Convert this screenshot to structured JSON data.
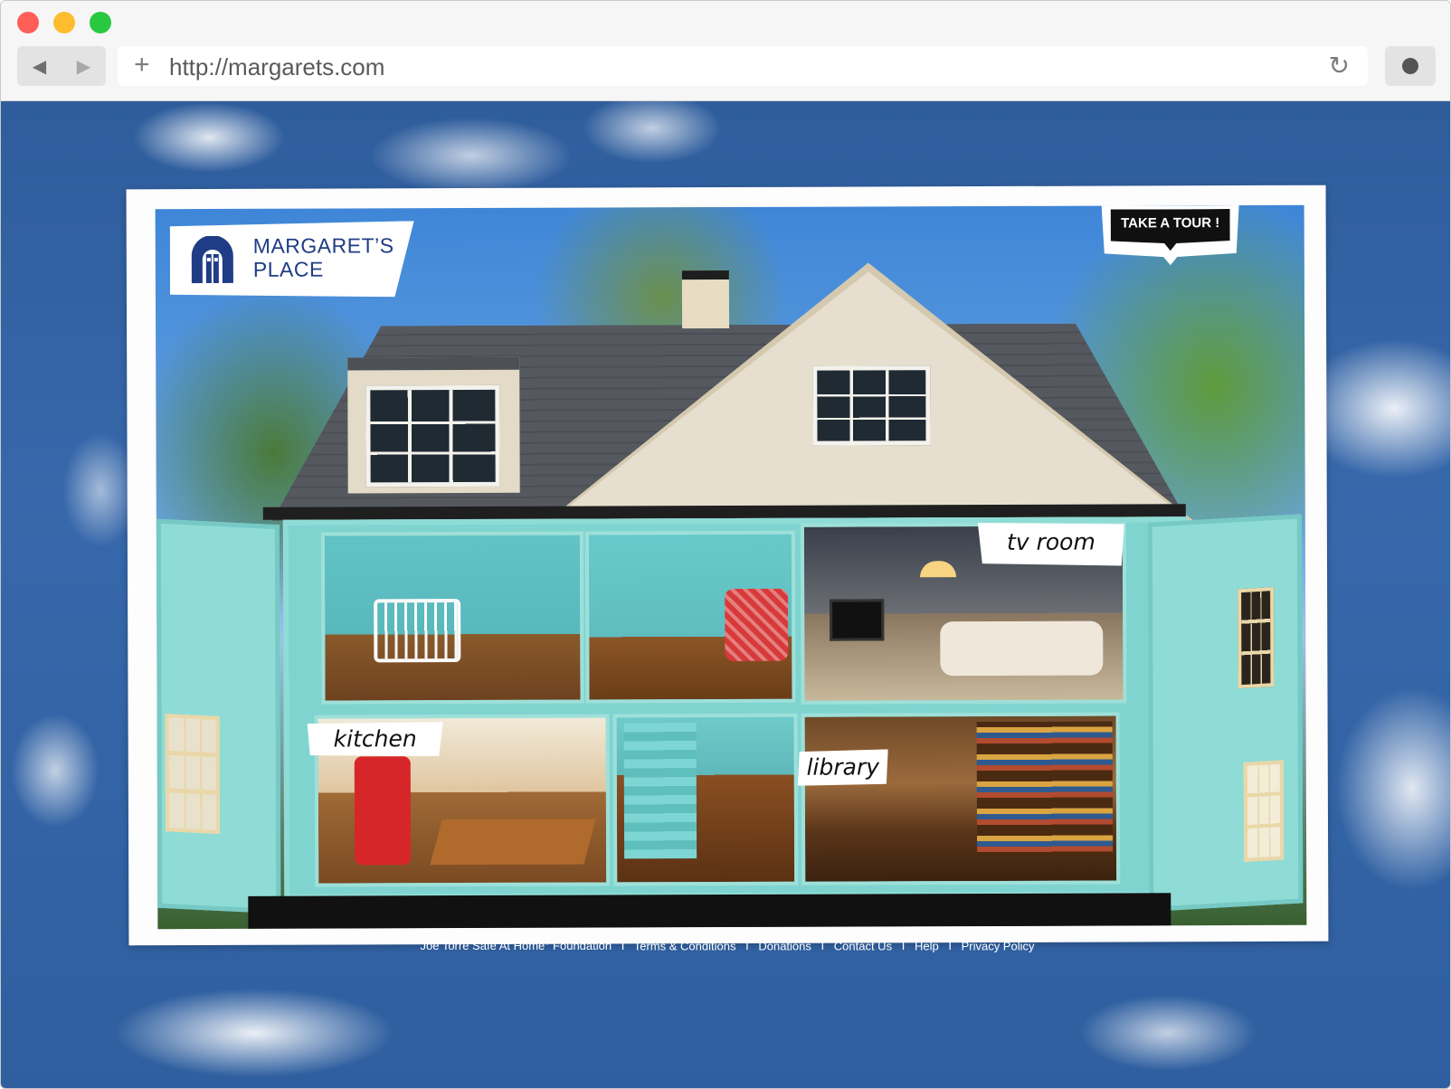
{
  "browser": {
    "url": "http://margarets.com",
    "buttons": {
      "back_icon": "back-arrow-icon",
      "forward_icon": "forward-arrow-icon",
      "new_tab_icon": "plus-icon",
      "reload_icon": "reload-icon",
      "extension_icon": "record-icon"
    }
  },
  "site": {
    "logo_line1": "MARGARET’S",
    "logo_line2": "PLACE",
    "tour_button": "TAKE A TOUR !",
    "rooms": {
      "tv_room": "tv room",
      "kitchen": "kitchen",
      "library": "library"
    },
    "colors": {
      "brand_blue": "#1f3d86",
      "house_teal": "#7fd4d0",
      "sky": "#3768ab"
    }
  },
  "footer": {
    "foundation": "Joe Torre Safe At Home",
    "foundation_mark": "®",
    "foundation_suffix": " Foundation",
    "sep": "I",
    "links": [
      "Terms & Conditions",
      "Donations",
      "Contact Us",
      "Help",
      "Privacy Policy"
    ]
  }
}
